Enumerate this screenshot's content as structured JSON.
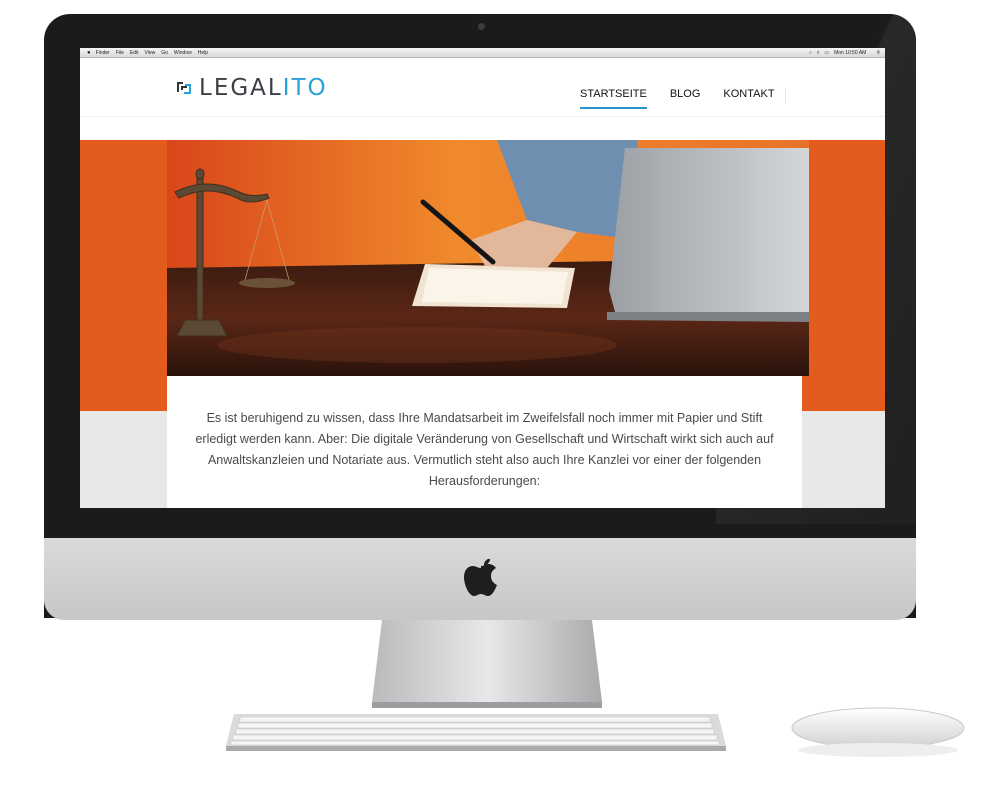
{
  "menubar": {
    "items": [
      "Finder",
      "File",
      "Edit",
      "View",
      "Go",
      "Window",
      "Help"
    ],
    "clock": "Mon 10:50 AM"
  },
  "site": {
    "logo_text_main": "LEGAL",
    "logo_text_accent": "ITO",
    "nav": [
      "STARTSEITE",
      "BLOG",
      "KONTAKT"
    ],
    "active_nav": "STARTSEITE",
    "intro_text": "Es ist beruhigend zu wissen, dass Ihre Mandatsarbeit im Zweifelsfall noch immer mit Papier und Stift erledigt werden kann. Aber: Die digitale Veränderung von Gesellschaft und Wirtschaft wirkt sich auch auf Anwaltskanzleien und Notariate aus. Vermutlich steht also auch Ihre Kanzlei vor einer der folgenden Herausforderungen:"
  },
  "colors": {
    "accent_blue": "#28a0d8",
    "hero_orange": "#e35b1d",
    "nav_underline": "#2c93cf"
  }
}
